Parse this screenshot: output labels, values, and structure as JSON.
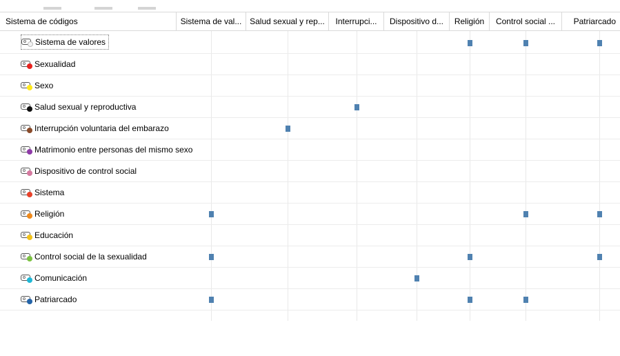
{
  "header": {
    "first_column": "Sistema de códigos",
    "columns": [
      "Sistema de val...",
      "Salud sexual y rep...",
      "Interrupci...",
      "Dispositivo d...",
      "Religión",
      "Control social ...",
      "Patriarcado"
    ]
  },
  "rows": [
    {
      "label": "Sistema de valores",
      "color": "#f2f2f2",
      "marks": [
        4,
        5,
        6
      ],
      "selected": true
    },
    {
      "label": "Sexualidad",
      "color": "#e8231f",
      "marks": []
    },
    {
      "label": "Sexo",
      "color": "#ffe81a",
      "marks": []
    },
    {
      "label": "Salud sexual y reproductiva",
      "color": "#111111",
      "marks": [
        2
      ]
    },
    {
      "label": "Interrupción voluntaria del embarazo",
      "color": "#8a4b2a",
      "marks": [
        1
      ]
    },
    {
      "label": "Matrimonio entre personas del mismo sexo",
      "color": "#8e3aa8",
      "marks": []
    },
    {
      "label": "Dispositivo de control social",
      "color": "#d67aa0",
      "marks": []
    },
    {
      "label": "Sistema",
      "color": "#e8412a",
      "marks": []
    },
    {
      "label": "Religión",
      "color": "#f08a1c",
      "marks": [
        0,
        5,
        6
      ]
    },
    {
      "label": "Educación",
      "color": "#f2c21a",
      "marks": []
    },
    {
      "label": "Control social de la sexualidad",
      "color": "#7cc242",
      "marks": [
        0,
        4,
        6
      ]
    },
    {
      "label": "Comunicación",
      "color": "#1fb8d6",
      "marks": [
        3
      ]
    },
    {
      "label": "Patriarcado",
      "color": "#2464a8",
      "marks": [
        0,
        4,
        5
      ]
    }
  ],
  "colors": {
    "mark": "#4f81b0",
    "gridline": "#e8e8e8",
    "header_border": "#d9d9d9"
  },
  "icons": {
    "code": "code-tag-icon"
  }
}
